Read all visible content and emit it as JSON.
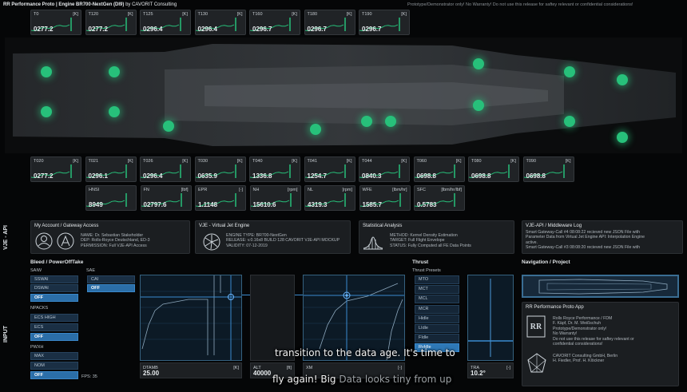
{
  "header": {
    "title": "RR Performance Proto | Engine BR700-NextGen (DI9)",
    "by": "by CAVORIT Consulting",
    "disclaimer": "Prototype/Demonstrator only! No Warranty! Do not use this release for saftey relevant or confidential considerations!"
  },
  "sensors_top": [
    {
      "label": "T0",
      "unit": "[K]",
      "value": "0277.2"
    },
    {
      "label": "T120",
      "unit": "[K]",
      "value": "0277.2"
    },
    {
      "label": "T125",
      "unit": "[K]",
      "value": "0296.4"
    },
    {
      "label": "T130",
      "unit": "[K]",
      "value": "0296.4"
    },
    {
      "label": "T160",
      "unit": "[K]",
      "value": "0296.7"
    },
    {
      "label": "T180",
      "unit": "[K]",
      "value": "0296.7"
    },
    {
      "label": "T190",
      "unit": "[K]",
      "value": "0296.7"
    }
  ],
  "sensors_mid": [
    {
      "label": "T020",
      "unit": "[K]",
      "value": "0277.2"
    },
    {
      "label": "T021",
      "unit": "[K]",
      "value": "0296.1"
    },
    {
      "label": "T026",
      "unit": "[K]",
      "value": "0296.4"
    },
    {
      "label": "T030",
      "unit": "[K]",
      "value": "0635.9"
    },
    {
      "label": "T040",
      "unit": "[K]",
      "value": "1336.8"
    },
    {
      "label": "T041",
      "unit": "[K]",
      "value": "1254.7"
    },
    {
      "label": "T044",
      "unit": "[K]",
      "value": "0840.3"
    },
    {
      "label": "T060",
      "unit": "[K]",
      "value": "0698.8"
    },
    {
      "label": "T080",
      "unit": "[K]",
      "value": "0698.8"
    },
    {
      "label": "T090",
      "unit": "[K]",
      "value": "0698.8"
    }
  ],
  "sensors_bottom": [
    {
      "label": "HNSI",
      "unit": "",
      "value": "8949"
    },
    {
      "label": "FN",
      "unit": "[lbf]",
      "value": "02797.6"
    },
    {
      "label": "EPR",
      "unit": "[-]",
      "value": "1.1148"
    },
    {
      "label": "NH",
      "unit": "[rpm]",
      "value": "15610.6"
    },
    {
      "label": "NL",
      "unit": "[rpm]",
      "value": "4319.3"
    },
    {
      "label": "WFE",
      "unit": "[lbm/hr]",
      "value": "1585.7"
    },
    {
      "label": "SFC",
      "unit": "[lbm/hr/lbf]",
      "value": "0.5783"
    }
  ],
  "side_labels": {
    "vje": "VJE - API",
    "input": "INPUT"
  },
  "cards": {
    "account": {
      "title": "My Account / Gateway Access",
      "lines": [
        "NAME: Dr. Sebastian Stakeholder",
        "DEP: Rolls-Royce Deutschland, ED-3",
        "PERMISSION: Full VJE-API Access"
      ]
    },
    "engine": {
      "title": "VJE - Virtual Jet Engine",
      "lines": [
        "ENGINE TYPE: BR700-NextGen",
        "RELEASE: v.0.16x8 BUILD 128 CAVORIT VJE-API MOCKUP",
        "VALIDITY: 07-12-2019"
      ]
    },
    "stats": {
      "title": "Statistical Analysis",
      "lines": [
        "METHOD: Kernel Density Estimation",
        "TARGET: Full Flight Envelope",
        "STATUS: Fully Computed all FE Data Points"
      ]
    },
    "log": {
      "title": "VJE-API / Middleware Log",
      "lines": [
        "Smart Gateway-Call #4 08:08:22 recieved new JSON File with",
        "Parameter Data from Virtual Jet Engine API: Interpolation Engine",
        "active.",
        "Smart Gateway-Call #3 08:08:20 recieved new JSON File with"
      ]
    }
  },
  "bleed": {
    "title": "Bleed / PowerOffTake",
    "saiw_label": "SAIW",
    "saiw": [
      "SSWAI",
      "DSWAI",
      "OFF"
    ],
    "sae_label": "SAE",
    "sae": [
      "CAI",
      "OFF"
    ],
    "npacks_label": "NPACKS",
    "npacks": [
      "ECS HIGH",
      "ECS",
      "OFF"
    ],
    "pwxh_label": "PWXH",
    "pwxh": [
      "MAX",
      "NOM",
      "OFF"
    ],
    "fps": "FPS: 35"
  },
  "charts": {
    "dtamb": {
      "label": "DTAMB",
      "unit": "[K]",
      "value": "25.00"
    },
    "alt": {
      "label": "ALT",
      "unit": "[ft]",
      "value": "40000"
    },
    "xm": {
      "label": "XM",
      "unit": "[-]",
      "value": ""
    },
    "tra": {
      "label": "TRA",
      "unit": "[-]",
      "value": "10.2°"
    }
  },
  "thrust": {
    "title": "Thrust",
    "presets_label": "Thrust Presets",
    "presets": [
      "MTO",
      "MCT",
      "MCL",
      "MCR",
      "Hidle",
      "LIdle",
      "FIdle",
      "RvIdle"
    ]
  },
  "nav": {
    "title": "Navigation / Project"
  },
  "app": {
    "title": "RR Performance Proto App",
    "lines1": [
      "Rolls Royce Performance / FDM",
      "F. Käpf, Dr. M. Weißschuh",
      "Prototype/Demonstrator only!",
      "No Warranty!",
      "Do not use this release for saftey relevant or",
      "confidential considerations!"
    ],
    "lines2": [
      "CAVORIT Consulting GmbH, Berlin",
      "H. Fiedler, Prof. H. Klöckner"
    ]
  },
  "subtitles": {
    "line1": "transition to the data age. It's time to",
    "line2a": "fly again! Big",
    "line2b": "Data looks tiny from up"
  },
  "colors": {
    "accent": "#2e78b6",
    "sensor_green": "#27c07a"
  }
}
